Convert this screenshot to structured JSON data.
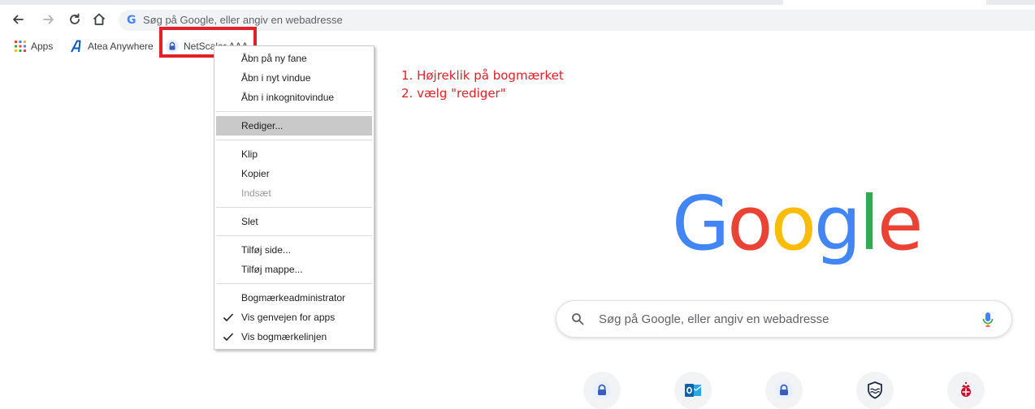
{
  "toolbar": {
    "omnibox_placeholder": "Søg på Google, eller angiv en webadresse"
  },
  "bookmarks": [
    {
      "label": "Apps",
      "icon": "apps-grid-icon"
    },
    {
      "label": "Atea Anywhere",
      "icon": "atea-logo-icon"
    },
    {
      "label": "NetScaler AAA",
      "icon": "lock-icon"
    }
  ],
  "context_menu": {
    "items": [
      {
        "label": "Åbn på ny fane"
      },
      {
        "label": "Åbn i nyt vindue"
      },
      {
        "label": "Åbn i inkognitovindue"
      },
      {
        "label": "Rediger..."
      },
      {
        "label": "Klip"
      },
      {
        "label": "Kopier"
      },
      {
        "label": "Indsæt"
      },
      {
        "label": "Slet"
      },
      {
        "label": "Tilføj side..."
      },
      {
        "label": "Tilføj mappe..."
      },
      {
        "label": "Bogmærkeadministrator"
      },
      {
        "label": "Vis genvejen for apps"
      },
      {
        "label": "Vis bogmærkelinjen"
      }
    ]
  },
  "annotation": {
    "step1": "1. Højreklik på bogmærket",
    "step2": "2. vælg \"rediger\""
  },
  "google": {
    "logo_letters": [
      "G",
      "o",
      "o",
      "g",
      "l",
      "e"
    ],
    "logo_colors": [
      "#4285F4",
      "#EA4335",
      "#FBBC05",
      "#4285F4",
      "#34A853",
      "#EA4335"
    ],
    "search_placeholder": "Søg på Google, eller angiv en webadresse"
  },
  "shortcuts": [
    {
      "icon": "lock-icon"
    },
    {
      "icon": "outlook-icon"
    },
    {
      "icon": "lock-icon"
    },
    {
      "icon": "shield-waves-icon"
    },
    {
      "icon": "royal-crest-icon"
    }
  ],
  "colors": {
    "annotation_red": "#e12028",
    "menu_hover": "#c9c9c9",
    "disabled_text": "#9a9a9a"
  }
}
